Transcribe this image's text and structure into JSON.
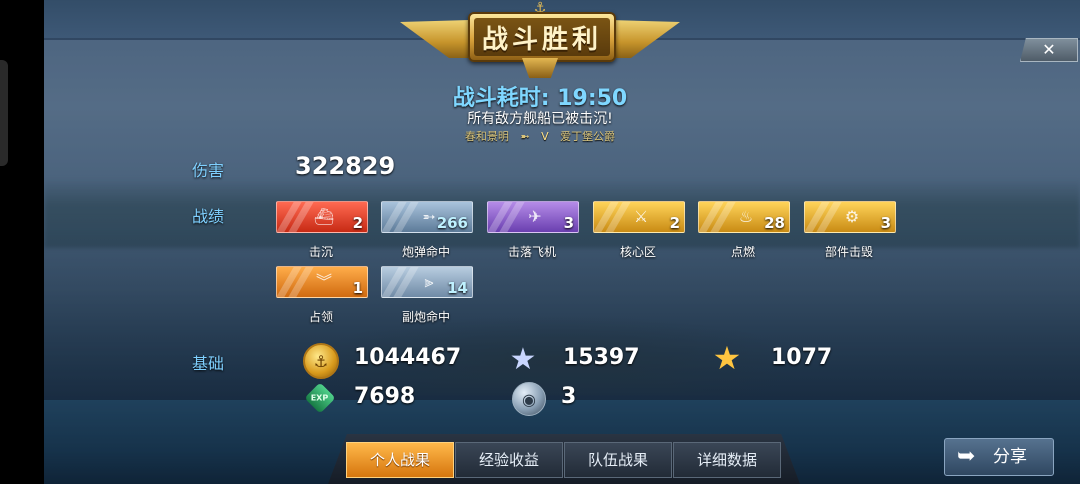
{
  "header": {
    "title": "战斗胜利",
    "close_symbol": "✕"
  },
  "battle": {
    "time_label": "战斗耗时: 19:50",
    "result_message": "所有敌方舰船已被击沉!",
    "team_a": "春和景明",
    "vs": "V",
    "team_b": "爱丁堡公爵"
  },
  "damage": {
    "label": "伤害",
    "value": "322829"
  },
  "achievements": {
    "label": "战绩",
    "items": [
      {
        "label": "击沉",
        "count": "2",
        "icon": "ship-sink-icon",
        "color": "#e8402a"
      },
      {
        "label": "炮弹命中",
        "count": "266",
        "icon": "shell-hit-icon",
        "color": "#7f9ab5"
      },
      {
        "label": "击落飞机",
        "count": "3",
        "icon": "plane-down-icon",
        "color": "#8a5ad0"
      },
      {
        "label": "核心区",
        "count": "2",
        "icon": "citadel-icon",
        "color": "#e6ae2e"
      },
      {
        "label": "点燃",
        "count": "28",
        "icon": "fire-icon",
        "color": "#e6ae2e"
      },
      {
        "label": "部件击毁",
        "count": "3",
        "icon": "gear-break-icon",
        "color": "#e6ae2e"
      },
      {
        "label": "占领",
        "count": "1",
        "icon": "capture-icon",
        "color": "#f08a20"
      },
      {
        "label": "副炮命中",
        "count": "14",
        "icon": "secondary-gun-icon",
        "color": "#8aa5c0"
      }
    ]
  },
  "basics": {
    "label": "基础",
    "credits": "1044467",
    "free_exp": "15397",
    "captain_exp": "1077",
    "exp": "7698",
    "globe_count": "3"
  },
  "tabs": [
    "个人战果",
    "经验收益",
    "队伍战果",
    "详细数据"
  ],
  "active_tab": "个人战果",
  "share_label": "分享"
}
